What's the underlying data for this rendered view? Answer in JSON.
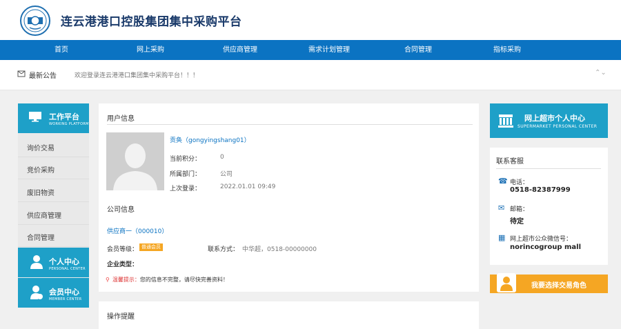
{
  "header": {
    "title": "连云港港口控股集团集中采购平台"
  },
  "nav": {
    "items": [
      "首页",
      "网上采购",
      "供应商管理",
      "需求计划管理",
      "合同管理",
      "指标采购"
    ]
  },
  "notice": {
    "title": "最新公告",
    "text": "欢迎登录连云港港口集团集中采购平台！！！"
  },
  "left_menu": {
    "workbench": {
      "title": "工作平台",
      "subtitle": "WORKING PLATFORM"
    },
    "items": [
      "询价交易",
      "竞价采购",
      "废旧物资",
      "供应商管理",
      "合同管理"
    ],
    "personal": {
      "title": "个人中心",
      "subtitle": "PERSONAL CENTER"
    },
    "member": {
      "title": "会员中心",
      "subtitle": "MEMBER CENTER"
    }
  },
  "user_info": {
    "section_title": "用户信息",
    "name": "贡奂（gongyingshang01）",
    "fields": [
      {
        "label": "当前积分：",
        "value": "0"
      },
      {
        "label": "所属部门：",
        "value": "公司"
      },
      {
        "label": "上次登录：",
        "value": "2022.01.01 09:49"
      }
    ]
  },
  "company_info": {
    "section_title": "公司信息",
    "supplier": "供应商一（000010）",
    "level_label": "会员等级：",
    "level_badge": "普通会员",
    "contact_label": "联系方式：",
    "contact_value": "中华超，0518-00000000",
    "type_label": "企业类型：",
    "tip_prefix": "温馨提示：",
    "tip_text": "您的信息不完整，请尽快完善资料！"
  },
  "operation": {
    "section_title": "操作提醒"
  },
  "promo": {
    "title": "网上超市个人中心",
    "subtitle": "SUPERMARKET PERSONAL CENTER"
  },
  "service": {
    "title": "联系客服",
    "phone_label": "电话：",
    "phone": "0518-82387999",
    "email_label": "邮箱：",
    "email": "待定",
    "wechat_label": "网上超市公众微信号：",
    "wechat": "norincogroup mall"
  },
  "role_button": {
    "label": "我要选择交易角色"
  },
  "colors": {
    "nav_blue": "#0b73c2",
    "panel_blue": "#1ea0c8",
    "orange": "#f5a623"
  }
}
